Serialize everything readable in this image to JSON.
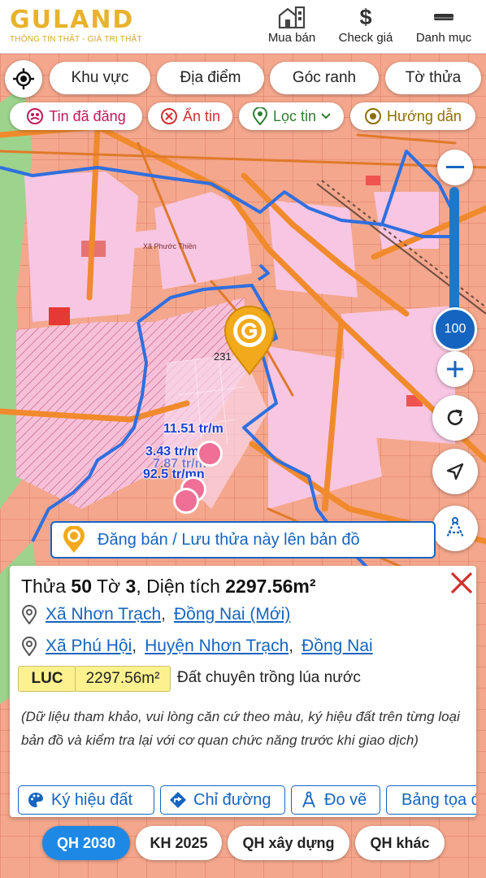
{
  "header": {
    "logo_text": "GULAND",
    "logo_tagline": "THÔNG TIN THẬT - GIÁ TRỊ THẬT",
    "nav": [
      {
        "label": "Mua bán",
        "icon": "building-icon"
      },
      {
        "label": "Check giá",
        "icon": "dollar-icon"
      },
      {
        "label": "Danh mục",
        "icon": "menu-icon"
      }
    ]
  },
  "filters": {
    "primary": [
      "Khu vực",
      "Địa điểm",
      "Góc ranh",
      "Tờ thửa"
    ],
    "secondary": [
      {
        "label": "Tin đã đăng",
        "color": "#c2185b"
      },
      {
        "label": "Ẩn tin",
        "color": "#d32f2f"
      },
      {
        "label": "Lọc tin",
        "color": "#2e7d32"
      },
      {
        "label": "Hướng dẫn",
        "color": "#8d6e00"
      }
    ]
  },
  "map": {
    "zoom_level": "100",
    "area_label": "Xã Phước Thiền",
    "marker_label": "231",
    "prices": [
      "11.51 tr/m",
      "3.43 tr/m",
      "7.87 tr/m",
      "92.5 tr/mn"
    ],
    "save_bar_text": "Đăng bán / Lưu thửa này lên bản đồ",
    "colors": {
      "urban": "#f4a78c",
      "residential": "#f7c6e2",
      "boundary": "#2f6fe0",
      "road": "#f08a2c"
    }
  },
  "parcel": {
    "prefix_thua": "Thửa",
    "thua": "50",
    "prefix_to": "Tờ",
    "to": "3",
    "prefix_area": ", Diện tích",
    "area": "2297.56m²",
    "new_address": {
      "commune": "Xã Nhơn Trạch",
      "province": "Đồng Nai (Mới)"
    },
    "old_address": {
      "commune": "Xã Phú Hội",
      "district": "Huyện Nhơn Trạch",
      "province": "Đồng Nai"
    },
    "land_code": "LUC",
    "land_area": "2297.56m²",
    "land_type": "Đất chuyên trồng lúa nước",
    "note": "(Dữ liệu tham khảo, vui lòng căn cứ theo màu, ký hiệu đất trên từng loại bản đồ và kiểm tra lại với cơ quan chức năng trước khi giao dịch)",
    "actions": [
      {
        "label": "Ký hiệu đất",
        "icon": "palette-icon"
      },
      {
        "label": "Chỉ đường",
        "icon": "directions-icon"
      },
      {
        "label": "Đo vẽ",
        "icon": "measure-icon"
      },
      {
        "label": "Bảng tọa độ",
        "icon": "table-icon"
      }
    ]
  },
  "plan_tabs": [
    {
      "label": "QH 2030",
      "active": true
    },
    {
      "label": "KH 2025",
      "active": false
    },
    {
      "label": "QH xây dựng",
      "active": false
    },
    {
      "label": "QH khác",
      "active": false
    }
  ]
}
